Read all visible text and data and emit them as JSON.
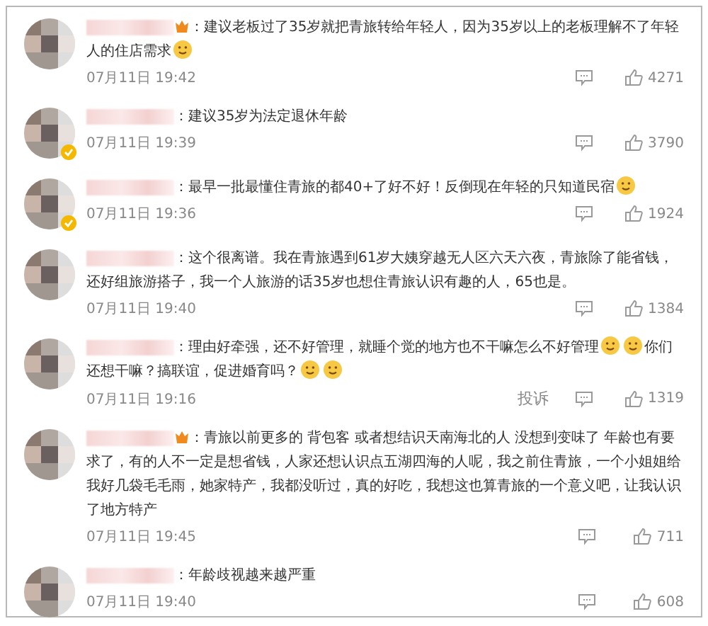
{
  "comments": [
    {
      "member_badge": true,
      "avatar_verified": false,
      "segments": [
        {
          "kind": "text",
          "text": "：建议老板过了35岁就把青旅转给年轻人，因为35岁以上的老板理解不了年轻人的住店需求"
        },
        {
          "kind": "emoji"
        }
      ],
      "time": "07月11日 19:42",
      "likes": "4271"
    },
    {
      "member_badge": false,
      "avatar_verified": true,
      "segments": [
        {
          "kind": "text",
          "text": "：建议35岁为法定退休年龄"
        }
      ],
      "time": "07月11日 19:39",
      "likes": "3790"
    },
    {
      "member_badge": false,
      "avatar_verified": true,
      "segments": [
        {
          "kind": "text",
          "text": "：最早一批最懂住青旅的都40+了好不好！反倒现在年轻的只知道民宿"
        },
        {
          "kind": "emoji"
        }
      ],
      "time": "07月11日 19:36",
      "likes": "1924"
    },
    {
      "member_badge": false,
      "avatar_verified": false,
      "segments": [
        {
          "kind": "text",
          "text": "：这个很离谱。我在青旅遇到61岁大姨穿越无人区六天六夜，青旅除了能省钱，还好组旅游搭子，我一个人旅游的话35岁也想住青旅认识有趣的人，65也是。"
        }
      ],
      "time": "07月11日 19:40",
      "likes": "1384"
    },
    {
      "member_badge": false,
      "avatar_verified": false,
      "segments": [
        {
          "kind": "text",
          "text": "：理由好牵强，还不好管理，就睡个觉的地方也不干嘛怎么不好管理"
        },
        {
          "kind": "emoji"
        },
        {
          "kind": "emoji"
        },
        {
          "kind": "text",
          "text": "你们还想干嘛？搞联谊，促进婚育吗？"
        },
        {
          "kind": "emoji"
        },
        {
          "kind": "emoji"
        }
      ],
      "time": "07月11日 19:16",
      "report": "投诉",
      "likes": "1319"
    },
    {
      "member_badge": true,
      "avatar_verified": false,
      "segments": [
        {
          "kind": "text",
          "text": "：青旅以前更多的 背包客 或者想结识天南海北的人 没想到变味了 年龄也有要求了，有的人不一定是想省钱，人家还想认识点五湖四海的人呢，我之前住青旅，一个小姐姐给我好几袋毛毛雨，她家特产，我都没听过，真的好吃，我想这也算青旅的一个意义吧，让我认识了地方特产"
        }
      ],
      "time": "07月11日 19:45",
      "likes": "711"
    },
    {
      "member_badge": false,
      "avatar_verified": false,
      "segments": [
        {
          "kind": "text",
          "text": "：年龄歧视越来越严重"
        }
      ],
      "time": "07月11日 19:40",
      "likes": "608"
    }
  ]
}
